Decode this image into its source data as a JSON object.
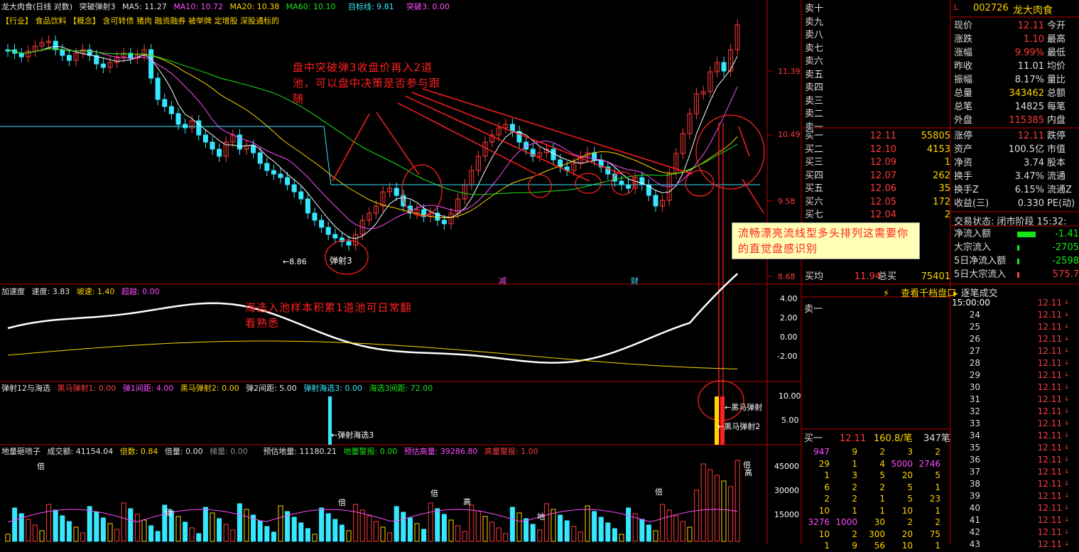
{
  "header": {
    "title": "龙大肉食(日线 对数)",
    "indicator": "突破弹射3",
    "ma5": "MA5: 11.27",
    "ma10": "MA10: 10.72",
    "ma20": "MA20: 10.38",
    "ma60": "MA60: 10.10",
    "target": "目标线: 9.81",
    "breakout": "突破3: 0.00"
  },
  "tags": "【行业】 食品饮料 【概念】 含可转债 猪肉 融资融券 被举牌 定增股 深股通标的",
  "price_axis": [
    "11.39",
    "10.49",
    "9.58",
    "8.68"
  ],
  "annotations": {
    "main": "盘中突破弹3收盘价再入2道池，可以盘中决策是否参与跟随",
    "circle_label": "弹射3",
    "low": "←8.86",
    "sea": "海选入池样本积累1道池可日常翻看熟悉",
    "tip": "流畅漂亮流线型多头排列这需要你的直觉盘感识别",
    "markers": [
      "减",
      "财"
    ]
  },
  "accel": {
    "title": "加速度",
    "speed": "速度: 3.83",
    "slope": "坡速: 1.40",
    "over": "超越: 0.00",
    "axis": [
      "4.00",
      "2.00",
      "0.00",
      "-2.00"
    ]
  },
  "shoot": {
    "title": "弹射12与海选",
    "h1": "黑马弹射1: 0.00",
    "g1": "弹1间距: 4.00",
    "h2": "黑马弹射2: 0.00",
    "g2": "弹2间距: 5.00",
    "s3": "弹射海选3: 0.00",
    "g3": "海选3间距: 72.00",
    "axis": [
      "10.00",
      "5.00"
    ],
    "lbl_sea": "←弹射海选3",
    "lbl_h": "←黑马弹射",
    "lbl_h2": "←黑马弹射2"
  },
  "vol": {
    "title": "地量砸喷子",
    "amount": "成交额: 41154.04",
    "mult": "倍数: 0.84",
    "bl": "倍量: 0.00",
    "xl": "梯量: 0.00",
    "est": "预估地量: 11180.21",
    "dlw": "地量警报: 0.00",
    "egl": "预估高量: 39286.80",
    "glw": "高量警报: 1.00",
    "axis": [
      "45000",
      "30000",
      "15000"
    ],
    "bei": "倍",
    "gao": "高",
    "di": "地"
  },
  "quote": {
    "code": "002726",
    "name": "龙大肉食",
    "asks": [
      "卖十",
      "卖九",
      "卖八",
      "卖七",
      "卖六",
      "卖五",
      "卖四",
      "卖三",
      "卖二",
      "卖一"
    ],
    "bids": [
      {
        "l": "买一",
        "p": "12.11",
        "v": "55805"
      },
      {
        "l": "买二",
        "p": "12.10",
        "v": "4153"
      },
      {
        "l": "买三",
        "p": "12.09",
        "v": "1"
      },
      {
        "l": "买四",
        "p": "12.07",
        "v": "262"
      },
      {
        "l": "买五",
        "p": "12.06",
        "v": "35"
      },
      {
        "l": "买六",
        "p": "12.05",
        "v": "172"
      },
      {
        "l": "买七",
        "p": "12.04",
        "v": "2"
      }
    ],
    "avg": {
      "l": "买均",
      "p": "11.94",
      "k": "总买",
      "v": "75401"
    },
    "stats": [
      {
        "k1": "现价",
        "v1": "12.11",
        "c1": "#ff3b3b",
        "k2": "今开"
      },
      {
        "k1": "涨跌",
        "v1": "1.10",
        "c1": "#ff3b3b",
        "k2": "最高"
      },
      {
        "k1": "涨幅",
        "v1": "9.99%",
        "c1": "#ff3b3b",
        "k2": "最低"
      },
      {
        "k1": "昨收",
        "v1": "11.01",
        "c1": "#ddd",
        "k2": "均价"
      },
      {
        "k1": "振幅",
        "v1": "8.17%",
        "c1": "#ddd",
        "k2": "量比"
      },
      {
        "k1": "总量",
        "v1": "343462",
        "c1": "#ffd400",
        "k2": "总额"
      },
      {
        "k1": "总笔",
        "v1": "14825",
        "c1": "#ddd",
        "k2": "每笔"
      },
      {
        "k1": "外盘",
        "v1": "115385",
        "c1": "#ff3b3b",
        "k2": "内盘"
      }
    ],
    "stats2": [
      {
        "k1": "涨停",
        "v1": "12.11",
        "c1": "#ff3b3b",
        "k2": "跌停"
      },
      {
        "k1": "资产",
        "v1": "100.5亿",
        "c1": "#ddd",
        "k2": "市值"
      },
      {
        "k1": "净资",
        "v1": "3.74",
        "c1": "#ddd",
        "k2": "股本"
      },
      {
        "k1": "换手",
        "v1": "3.47%",
        "c1": "#ddd",
        "k2": "流通"
      },
      {
        "k1": "换手Z",
        "v1": "6.15%",
        "c1": "#ddd",
        "k2": "流通Z"
      },
      {
        "k1": "收益(三)",
        "v1": "0.330",
        "c1": "#ddd",
        "k2": "PE(动)"
      }
    ],
    "status": "交易状态: 闭市阶段 15:32:",
    "flows": [
      {
        "k": "净流入额",
        "v": "-1.41"
      },
      {
        "k": "大宗流入",
        "v": "-2705"
      },
      {
        "k": "5日净流入额",
        "v": "-2598"
      },
      {
        "k": "5日大宗流入",
        "v": "575.7"
      }
    ],
    "view_btn": "查看千档盘口",
    "ticks_title": "逐笔成交",
    "ask1": "卖一",
    "bottom": {
      "l": "买一",
      "p": "12.11",
      "a": "160.8/笔",
      "c": "347笔"
    },
    "grid": [
      [
        "947",
        "9",
        "2",
        "3",
        "2"
      ],
      [
        "29",
        "1",
        "4",
        "5000",
        "2746"
      ],
      [
        "1",
        "3",
        "5",
        "20",
        "5"
      ],
      [
        "6",
        "2",
        "2",
        "5",
        "1"
      ],
      [
        "2",
        "2",
        "1",
        "5",
        "23"
      ],
      [
        "10",
        "1",
        "1",
        "10",
        "1"
      ],
      [
        "3276",
        "1000",
        "30",
        "2",
        "2"
      ],
      [
        "10",
        "2",
        "300",
        "20",
        "75"
      ],
      [
        "1",
        "9",
        "56",
        "10",
        "1"
      ]
    ],
    "times": [
      "15:00:00",
      "24",
      "25",
      "26",
      "27",
      "28",
      "29",
      "30",
      "31",
      "32",
      "33",
      "34",
      "35",
      "36",
      "37",
      "38",
      "39",
      "40",
      "41",
      "42",
      "43"
    ],
    "tick_price": "12.11"
  },
  "colors": {
    "up": "#ff3b3b",
    "down": "#36e8ff",
    "ma5": "#ffffff",
    "ma10": "#ff4cff",
    "ma20": "#ffd400",
    "ma60": "#19e619",
    "target": "#36e8ff"
  }
}
